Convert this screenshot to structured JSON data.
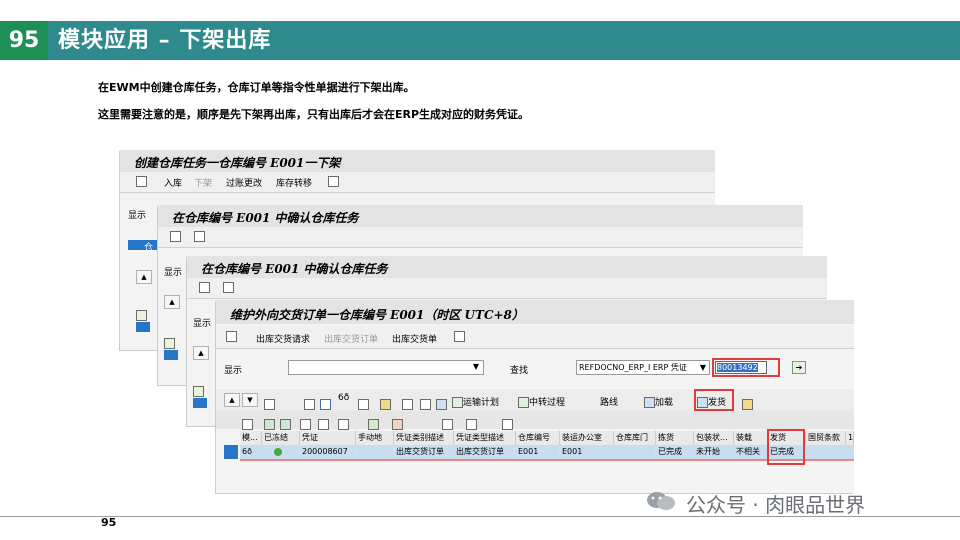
{
  "slide": {
    "number": "95",
    "title": "模块应用 – 下架出库",
    "intro_line1": "在EWM中创建仓库任务，仓库订单等指令性单据进行下架出库。",
    "intro_line2": "这里需要注意的是，顺序是先下架再出库，只有出库后才会在ERP生成对应的财务凭证。",
    "footer_page": "95",
    "watermark": "公众号 · 肉眼品世界"
  },
  "win1": {
    "title": "创建仓库任务一仓库编号 E001一下架",
    "toolbar": [
      "入库",
      "下架",
      "过账更改",
      "库存转移"
    ],
    "side_label": "显示",
    "tab": "仓"
  },
  "win2": {
    "title": "在仓库编号 E001 中确认仓库任务",
    "side_label": "显示"
  },
  "win3": {
    "title": "在仓库编号 E001 中确认仓库任务",
    "side_label": "显示"
  },
  "win4": {
    "title": "维护外向交货订单一仓库编号 E001（时区 UTC+8）",
    "toolbar": [
      "出库交货请求",
      "出库交货订单",
      "出库交货单"
    ],
    "display_label": "显示",
    "search_label": "查找",
    "search_type": "REFDOCNO_ERP_I ERP 凭证",
    "search_value": "80013492",
    "btn_transport": "运输计划",
    "btn_transfer": "中转过程",
    "btn_route": "路线",
    "btn_load": "加载",
    "btn_ship": "发货",
    "columns": [
      "模...",
      "已冻结",
      "凭证",
      "手动地",
      "凭证类别描述",
      "凭证类型描述",
      "仓库编号",
      "装运办公室",
      "仓库库门",
      "拣货",
      "包装状...",
      "装载",
      "发货",
      "国贸条款",
      "1"
    ],
    "row": {
      "glasses": "6ð",
      "document": "200008607",
      "category_desc": "出库交货订单",
      "type_desc": "出库交货订单",
      "warehouse": "E001",
      "office": "E001",
      "picking": "已完成",
      "packing": "未开始",
      "loading": "不相关",
      "shipping": "已完成"
    }
  },
  "colors": {
    "header": "#2f8a8d",
    "number_box": "#1e8f55",
    "highlight": "#e03c3c",
    "row_select": "#c8ddef"
  }
}
